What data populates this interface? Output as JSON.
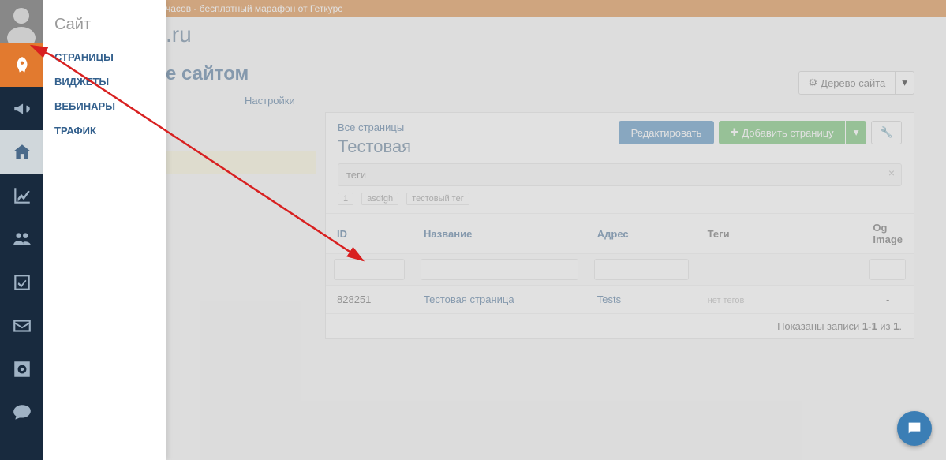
{
  "banner": "часов - бесплатный марафон от Геткурс",
  "domain_tail": ".ru",
  "flyout": {
    "title": "Сайт",
    "items": [
      "СТРАНИЦЫ",
      "ВИДЖЕТЫ",
      "ВЕБИНАРЫ",
      "ТРАФИК"
    ]
  },
  "page": {
    "title_tail": "е сайтом",
    "settings_link": "Настройки",
    "tree_button": "Дерево сайта"
  },
  "panel": {
    "all_pages": "Все страницы",
    "title": "Тестовая",
    "edit_btn": "Редактировать",
    "add_btn": "Добавить страницу",
    "tags_placeholder": "теги",
    "chips": [
      "1",
      "asdfgh",
      "тестовый тег"
    ]
  },
  "table": {
    "headers": {
      "id": "ID",
      "name": "Название",
      "addr": "Адрес",
      "tags": "Теги",
      "og": "Og Image"
    },
    "row": {
      "id": "828251",
      "name": "Тестовая страница",
      "addr": "Tests",
      "tags": "нет тегов",
      "og": "-"
    },
    "summary_prefix": "Показаны записи ",
    "summary_range": "1-1",
    "summary_of": " из ",
    "summary_total": "1"
  }
}
